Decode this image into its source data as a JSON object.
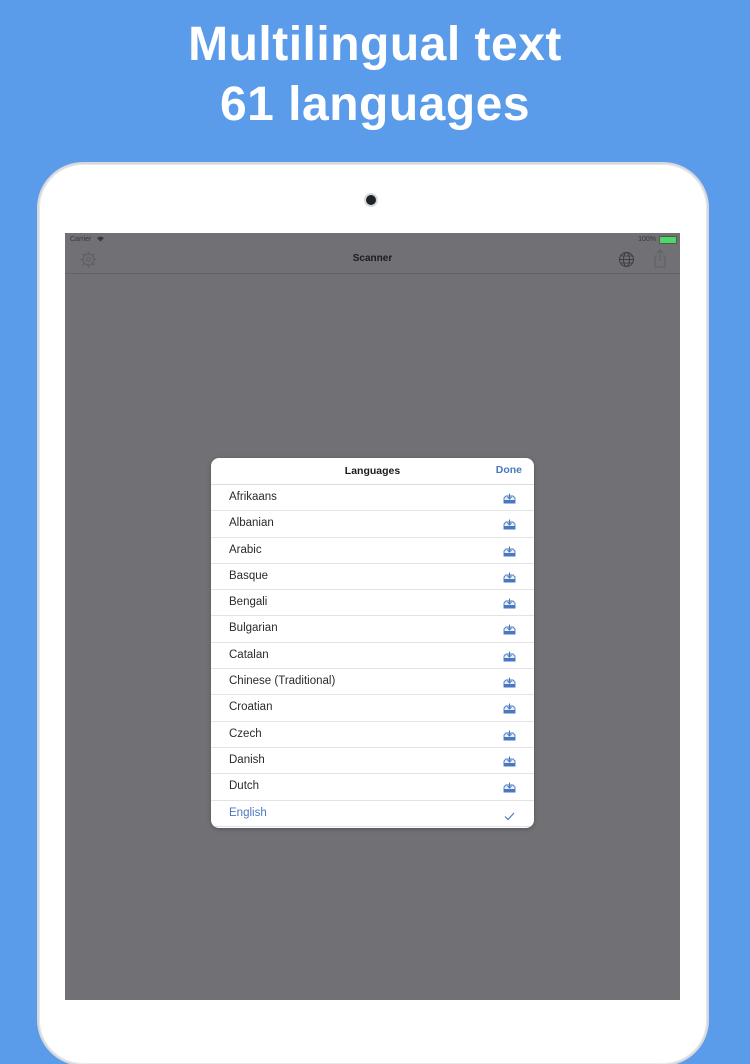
{
  "promo": {
    "line1": "Multilingual text",
    "line2": "61 languages"
  },
  "statusbar": {
    "carrier": "Carrier",
    "battery": "100%"
  },
  "navbar": {
    "title": "Scanner"
  },
  "languages_popover": {
    "title": "Languages",
    "done_label": "Done",
    "items": [
      {
        "label": "Afrikaans",
        "state": "download"
      },
      {
        "label": "Albanian",
        "state": "download"
      },
      {
        "label": "Arabic",
        "state": "download"
      },
      {
        "label": "Basque",
        "state": "download"
      },
      {
        "label": "Bengali",
        "state": "download"
      },
      {
        "label": "Bulgarian",
        "state": "download"
      },
      {
        "label": "Catalan",
        "state": "download"
      },
      {
        "label": "Chinese (Traditional)",
        "state": "download"
      },
      {
        "label": "Croatian",
        "state": "download"
      },
      {
        "label": "Czech",
        "state": "download"
      },
      {
        "label": "Danish",
        "state": "download"
      },
      {
        "label": "Dutch",
        "state": "download"
      },
      {
        "label": "English",
        "state": "selected"
      }
    ]
  },
  "colors": {
    "background": "#5a9bea",
    "accent": "#4a78c0",
    "screen": "#707075"
  }
}
